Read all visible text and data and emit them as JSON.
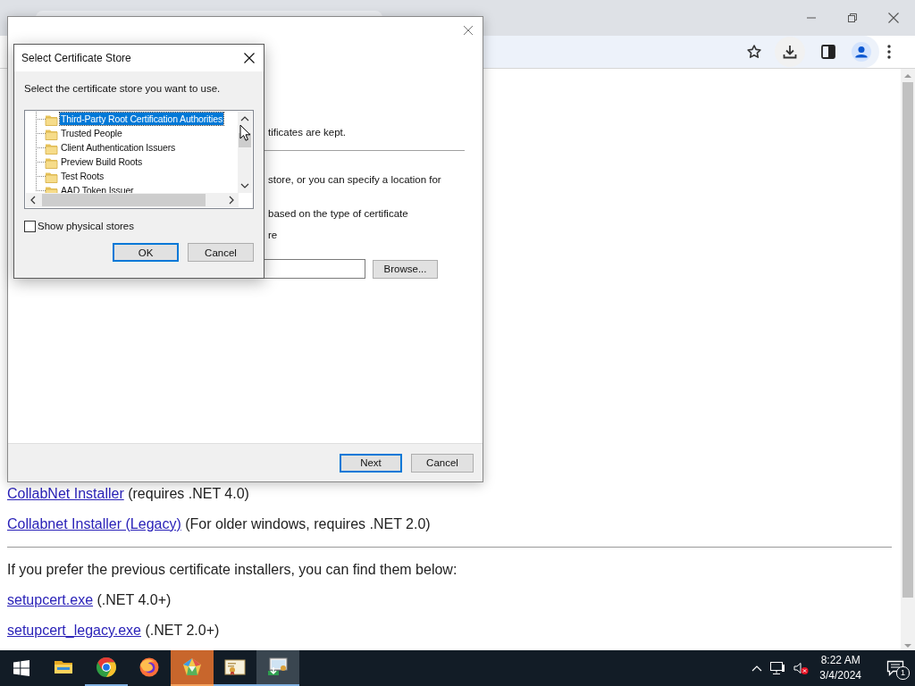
{
  "browser": {
    "page": {
      "installers": [
        {
          "link": "CollabNet Installer",
          "note": "(requires .NET 4.0)"
        },
        {
          "link": "Collabnet Installer (Legacy)",
          "note": "(For older windows, requires .NET 2.0)"
        }
      ],
      "intro": "If you prefer the previous certificate installers, you can find them below:",
      "legacy_installers": [
        {
          "link": "setupcert.exe",
          "note": "(.NET 4.0+)"
        },
        {
          "link": "setupcert_legacy.exe",
          "note": "(.NET 2.0+)"
        }
      ]
    }
  },
  "wizard": {
    "partial_texts": [
      "tificates are kept.",
      "store, or you can specify a location for",
      "based on the type of certificate",
      "re"
    ],
    "browse_button": "Browse...",
    "buttons": [
      {
        "label": "Next",
        "default": true
      },
      {
        "label": "Cancel",
        "default": false
      }
    ]
  },
  "dialog": {
    "title": "Select Certificate Store",
    "prompt": "Select the certificate store you want to use.",
    "stores": [
      {
        "label": "Third-Party Root Certification Authorities",
        "selected": true
      },
      {
        "label": "Trusted People",
        "selected": false
      },
      {
        "label": "Client Authentication Issuers",
        "selected": false
      },
      {
        "label": "Preview Build Roots",
        "selected": false
      },
      {
        "label": "Test Roots",
        "selected": false
      },
      {
        "label": "AAD Token Issuer",
        "selected": false
      }
    ],
    "show_physical_stores": {
      "label": "Show physical stores",
      "checked": false
    },
    "buttons": [
      {
        "label": "OK",
        "default": true
      },
      {
        "label": "Cancel",
        "default": false
      }
    ]
  },
  "taskbar": {
    "apps": [
      {
        "kind": "folder",
        "running": false,
        "flashing": false,
        "selected": false
      },
      {
        "kind": "chrome",
        "running": true,
        "flashing": false,
        "selected": false
      },
      {
        "kind": "firefox",
        "running": false,
        "flashing": false,
        "selected": false
      },
      {
        "kind": "pentagon",
        "running": true,
        "flashing": true,
        "selected": false
      },
      {
        "kind": "certificate",
        "running": true,
        "flashing": false,
        "selected": false
      },
      {
        "kind": "certinstall",
        "running": true,
        "flashing": false,
        "selected": true
      }
    ],
    "clock": {
      "time": "8:22 AM",
      "date": "3/4/2024"
    },
    "notifications": "1"
  }
}
